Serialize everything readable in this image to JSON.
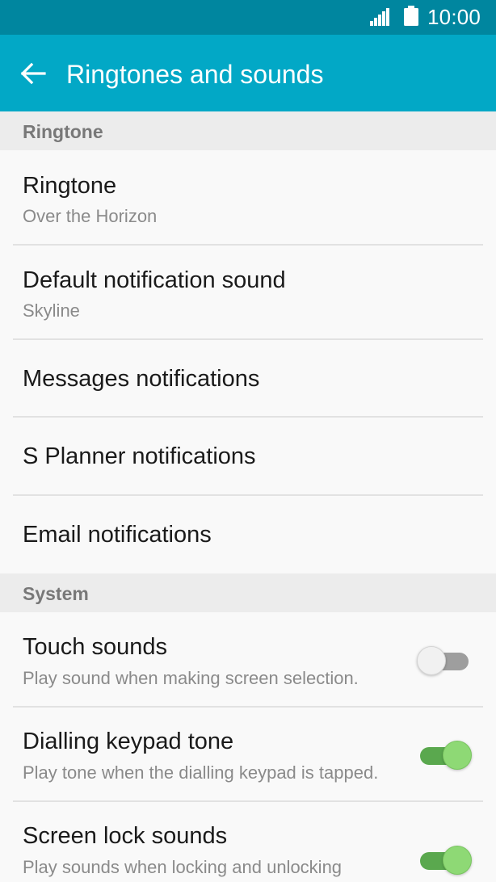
{
  "status_bar": {
    "time": "10:00",
    "signal_icon": "signal-strength-icon",
    "battery_icon": "battery-full-icon"
  },
  "app_bar": {
    "back_icon": "back-arrow-icon",
    "title": "Ringtones and sounds"
  },
  "sections": {
    "ringtone": {
      "header": "Ringtone",
      "items": [
        {
          "title": "Ringtone",
          "subtitle": "Over the Horizon"
        },
        {
          "title": "Default notification sound",
          "subtitle": "Skyline"
        },
        {
          "title": "Messages notifications"
        },
        {
          "title": "S Planner notifications"
        },
        {
          "title": "Email notifications"
        }
      ]
    },
    "system": {
      "header": "System",
      "items": [
        {
          "title": "Touch sounds",
          "subtitle": "Play sound when making screen selection.",
          "enabled": false
        },
        {
          "title": "Dialling keypad tone",
          "subtitle": "Play tone when the dialling keypad is tapped.",
          "enabled": true
        },
        {
          "title": "Screen lock sounds",
          "subtitle": "Play sounds when locking and unlocking",
          "enabled": true
        }
      ]
    }
  },
  "colors": {
    "status_bar": "#00869f",
    "app_bar": "#02a8c6",
    "switch_on": "#8ed975",
    "switch_off": "#9e9e9e"
  }
}
